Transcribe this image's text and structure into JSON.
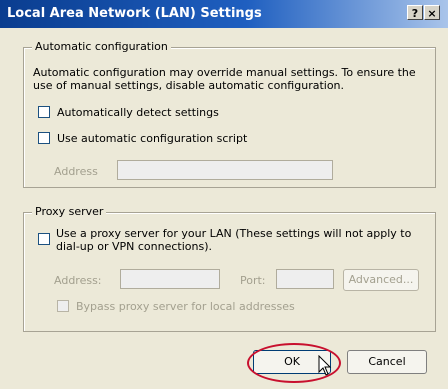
{
  "window": {
    "title": "Local Area Network (LAN) Settings",
    "help_label": "?",
    "close_label": "×"
  },
  "auto_config": {
    "legend": "Automatic configuration",
    "description_line1": "Automatic configuration may override manual settings.  To ensure the",
    "description_line2": "use of manual settings, disable automatic configuration.",
    "auto_detect": {
      "label": "Automatically detect settings",
      "checked": false
    },
    "use_script": {
      "label": "Use automatic configuration script",
      "checked": false
    },
    "address_label": "Address",
    "address_value": ""
  },
  "proxy": {
    "legend": "Proxy server",
    "use_proxy_line1": "Use a proxy server for your LAN (These settings will not apply to",
    "use_proxy_line2": "dial-up or VPN connections).",
    "use_proxy_checked": false,
    "address_label": "Address:",
    "address_value": "",
    "port_label": "Port:",
    "port_value": "",
    "advanced_label": "Advanced...",
    "bypass_label": "Bypass proxy server for local addresses",
    "bypass_checked": false
  },
  "buttons": {
    "ok_label": "OK",
    "cancel_label": "Cancel"
  }
}
